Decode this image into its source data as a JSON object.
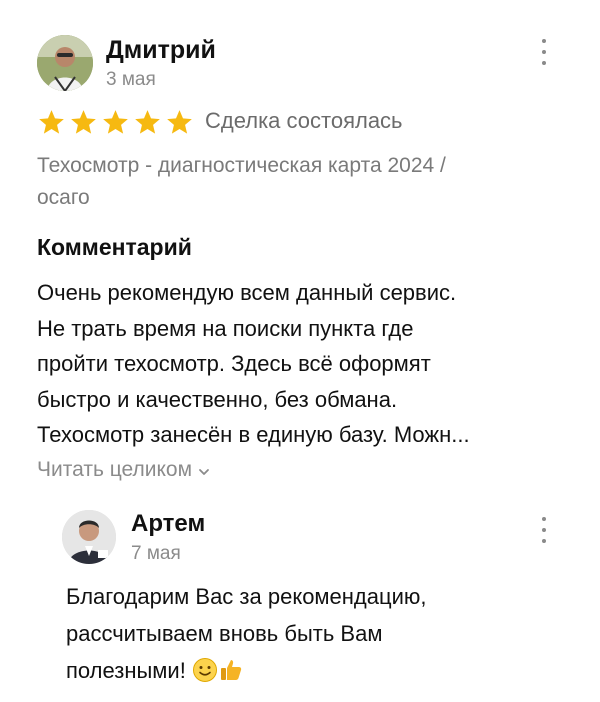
{
  "review": {
    "author": "Дмитрий",
    "date": "3 мая",
    "rating": 5,
    "rating_max": 5,
    "deal_status": "Сделка состоялась",
    "service_line1": "Техосмотр - диагностическая карта 2024 /",
    "service_line2": "осаго",
    "comment_title": "Комментарий",
    "comment_lines": [
      "Очень рекомендую всем данный сервис.",
      "Не трать время на поиски пункта где",
      "пройти техосмотр. Здесь всё оформят",
      "быстро и качественно, без обмана.",
      "Техосмотр занесён в единую базу. Можн..."
    ],
    "read_more": "Читать целиком"
  },
  "reply": {
    "author": "Артем",
    "date": "7 мая",
    "lines": [
      "Благодарим Вас за рекомендацию,",
      "рассчитываем вновь быть Вам",
      "полезными!"
    ],
    "emojis": [
      "slightly-smiling-face",
      "thumbs-up"
    ]
  },
  "colors": {
    "star": "#f6b911",
    "muted_text": "#8b8b8b",
    "text": "#111111"
  }
}
